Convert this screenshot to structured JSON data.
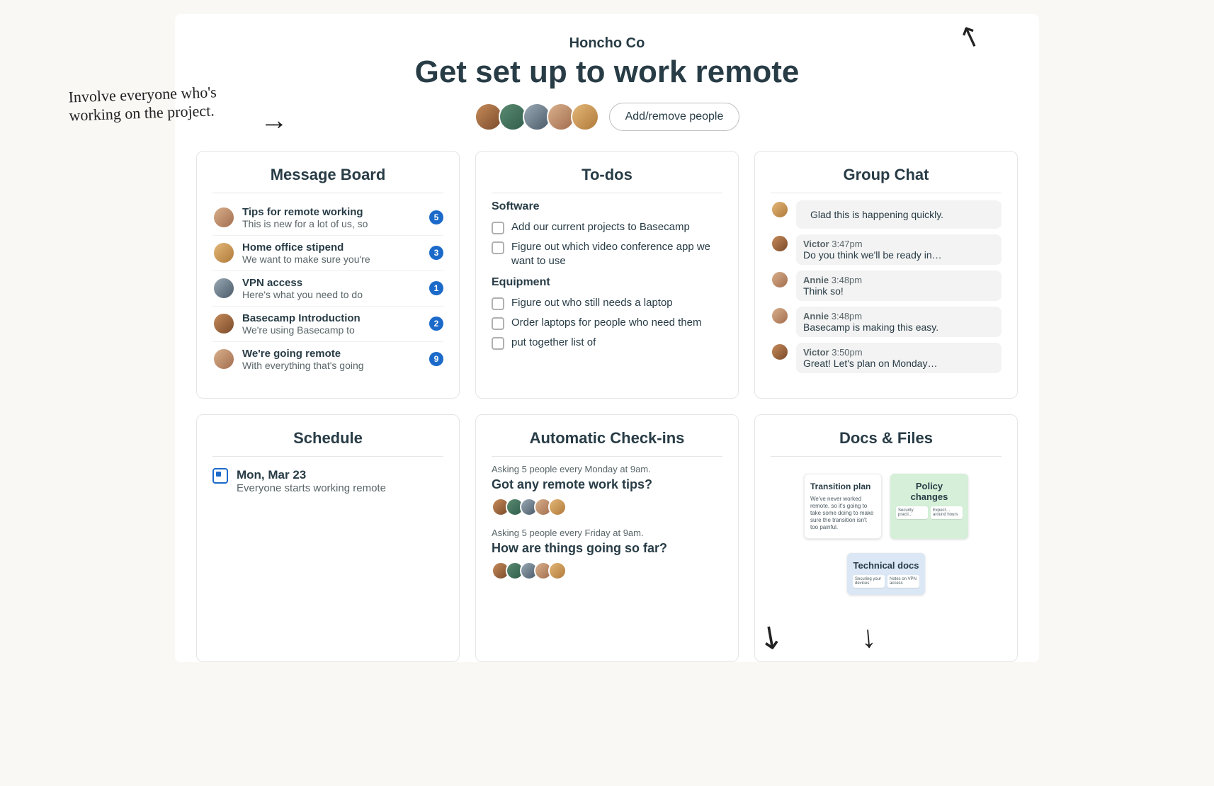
{
  "annotations": {
    "handwritten": "Involve everyone who's working on the project."
  },
  "header": {
    "company": "Honcho Co",
    "title": "Get set up to work remote",
    "add_people_label": "Add/remove people"
  },
  "cards": {
    "message_board": {
      "title": "Message Board",
      "items": [
        {
          "title": "Tips for remote working",
          "preview": "This is new for a lot of us, so",
          "count": 5
        },
        {
          "title": "Home office stipend",
          "preview": "We want to make sure you're",
          "count": 3
        },
        {
          "title": "VPN access",
          "preview": "Here's what you need to do",
          "count": 1
        },
        {
          "title": "Basecamp Introduction",
          "preview": "We're using Basecamp to",
          "count": 2
        },
        {
          "title": "We're going remote",
          "preview": "With everything that's going",
          "count": 9
        }
      ]
    },
    "todos": {
      "title": "To-dos",
      "sections": [
        {
          "label": "Software",
          "items": [
            "Add our current projects to Basecamp",
            "Figure out which video conference app we want to use"
          ]
        },
        {
          "label": "Equipment",
          "items": [
            "Figure out who still needs a laptop",
            "Order laptops for people who need them",
            "put together list of"
          ]
        }
      ]
    },
    "group_chat": {
      "title": "Group Chat",
      "top_line": "Glad this is happening quickly.",
      "messages": [
        {
          "name": "Victor",
          "time": "3:47pm",
          "body": "Do you think we'll be ready in…"
        },
        {
          "name": "Annie",
          "time": "3:48pm",
          "body": "Think so!"
        },
        {
          "name": "Annie",
          "time": "3:48pm",
          "body": "Basecamp is making this easy."
        },
        {
          "name": "Victor",
          "time": "3:50pm",
          "body": "Great! Let's plan on Monday…"
        }
      ]
    },
    "schedule": {
      "title": "Schedule",
      "date": "Mon, Mar 23",
      "desc": "Everyone starts working remote"
    },
    "checkins": {
      "title": "Automatic Check-ins",
      "blocks": [
        {
          "sub": "Asking 5 people every Monday at 9am.",
          "question": "Got any remote work tips?"
        },
        {
          "sub": "Asking 5 people every Friday at 9am.",
          "question": "How are things going so far?"
        }
      ]
    },
    "docs": {
      "title": "Docs & Files",
      "items": [
        {
          "kind": "white",
          "title": "Transition plan",
          "body": "We've never worked remote, so it's going to take some doing to make sure the transition isn't too painful."
        },
        {
          "kind": "green",
          "title": "Policy changes",
          "mini": [
            "Security practi…",
            "Expect… around hours"
          ]
        },
        {
          "kind": "blue",
          "title": "Technical docs",
          "mini": [
            "Securing your devices",
            "Notes on VPN access"
          ]
        }
      ]
    }
  }
}
